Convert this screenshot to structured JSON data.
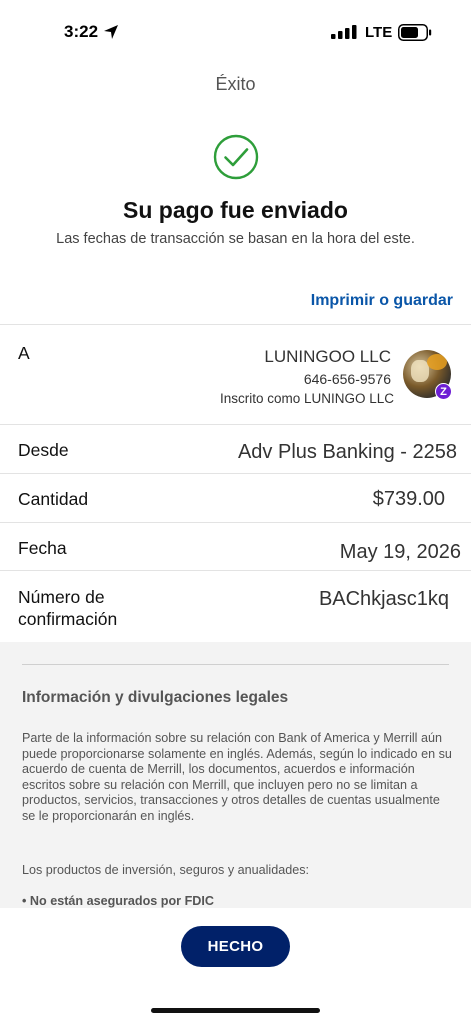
{
  "status_bar": {
    "time": "3:22",
    "network": "LTE"
  },
  "nav": {
    "title": "Éxito"
  },
  "confirmation": {
    "headline": "Su pago fue enviado",
    "subtext": "Las fechas de transacción se basan en la hora del este."
  },
  "actions": {
    "print_label": "Imprimir o guardar"
  },
  "details": {
    "to": {
      "label": "A",
      "name": "LUNINGOO LLC",
      "phone": "646-656-9576",
      "enrolled": "Inscrito como LUNINGO LLC",
      "badge": "Z"
    },
    "from": {
      "label": "Desde",
      "value": "Adv Plus Banking - 2258"
    },
    "amount": {
      "label": "Cantidad",
      "value": "$739.00"
    },
    "date": {
      "label": "Fecha",
      "value": "May 19, 2026"
    },
    "confirmation": {
      "label_line1": "Número de",
      "label_line2": "confirmación",
      "value": "BAChkjasc1kq"
    }
  },
  "legal": {
    "title": "Información y divulgaciones legales",
    "paragraph": "Parte de la información sobre su relación con Bank of America y Merrill aún puede proporcionarse solamente en inglés. Además, según lo indicado en su acuerdo de cuenta de Merrill, los documentos, acuerdos e información escritos sobre su relación con Merrill, que incluyen pero no se limitan a productos, servicios, transacciones y otros detalles de cuentas usualmente se le proporcionarán en inglés.",
    "paragraph2": "Los productos de inversión, seguros y anualidades:",
    "bullet": "• No están asegurados por FDIC"
  },
  "footer": {
    "done_label": "HECHO"
  },
  "colors": {
    "accent_link": "#0a56a8",
    "primary_button": "#012169",
    "success": "#2e9e3a",
    "zelle": "#6d1ed4"
  }
}
